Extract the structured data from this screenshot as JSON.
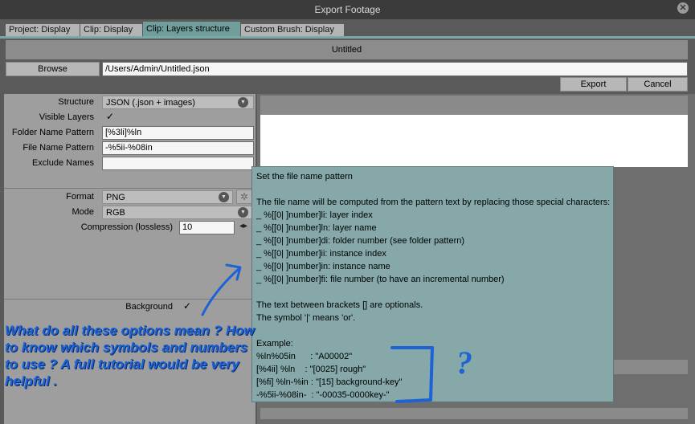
{
  "window": {
    "title": "Export Footage"
  },
  "tabs": [
    {
      "label": "Project: Display"
    },
    {
      "label": "Clip: Display"
    },
    {
      "label": "Clip: Layers structure"
    },
    {
      "label": "Custom Brush: Display"
    }
  ],
  "header": {
    "title": "Untitled"
  },
  "browse": {
    "label": "Browse",
    "path": "/Users/Admin/Untitled.json"
  },
  "actions": {
    "export": "Export",
    "cancel": "Cancel"
  },
  "form": {
    "structure_label": "Structure",
    "structure_value": "JSON (.json + images)",
    "visible_layers_label": "Visible Layers",
    "visible_layers_check": "✓",
    "folder_label": "Folder Name Pattern",
    "folder_value": "[%3li]%ln",
    "file_label": "File Name Pattern",
    "file_value": "-%5ii-%08in",
    "exclude_label": "Exclude Names",
    "exclude_value": "",
    "format_label": "Format",
    "format_value": "PNG",
    "mode_label": "Mode",
    "mode_value": "RGB",
    "compression_label": "Compression (lossless)",
    "compression_value": "10",
    "background_label": "Background",
    "background_check": "✓"
  },
  "tooltip": {
    "lines": [
      "Set the file name pattern",
      "",
      "The file name will be computed from the pattern text by replacing those special characters:",
      "_ %[[0| ]number]li: layer index",
      "_ %[[0| ]number]ln: layer name",
      "_ %[[0| ]number]di: folder number (see folder pattern)",
      "_ %[[0| ]number]ii: instance index",
      "_ %[[0| ]number]in: instance name",
      "_ %[[0| ]number]fi: file number (to have an incremental number)",
      "",
      "The text between brackets [] are optionals.",
      "The symbol '|' means 'or'.",
      "",
      "Example:",
      "%ln%05in      : \"A00002\"",
      "[%4ii] %ln    : \"[0025] rough\"",
      "[%fi] %ln-%in : \"[15] background-key\"",
      "-%5ii-%08in-  : \"-00035-0000key-\""
    ]
  },
  "annotation": {
    "text": "What do all these options mean ?  How to know which symbols and numbers to use ? A full tutorial would be very helpful .",
    "question_mark": "?"
  },
  "colors": {
    "accent_tab": "#6f9e9b",
    "tooltip_bg": "#86a8a8",
    "annotation_blue": "#1d63d6"
  },
  "icons": {
    "close": "close-icon",
    "combo_arrow": "chevron-down-icon",
    "format_settings": "gear-icon",
    "compression_arrows": "stepper-icon"
  }
}
